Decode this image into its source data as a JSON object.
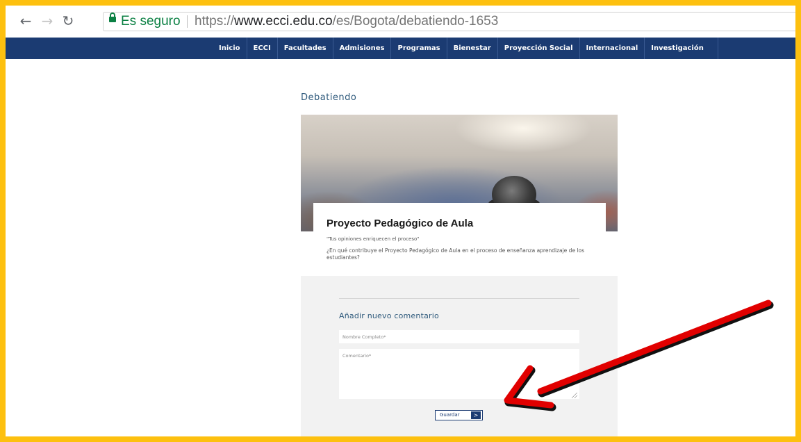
{
  "browser": {
    "secure_label": "Es seguro",
    "url_prefix": "https://",
    "url_host": "www.ecci.edu.co",
    "url_path": "/es/Bogota/debatiendo-1653",
    "back_icon": "back-arrow-icon",
    "forward_icon": "forward-arrow-icon",
    "reload_icon": "reload-icon",
    "lock_icon": "lock-icon"
  },
  "nav": {
    "items": [
      "Inicio",
      "ECCI",
      "Facultades",
      "Admisiones",
      "Programas",
      "Bienestar",
      "Proyección Social",
      "Internacional",
      "Investigación"
    ]
  },
  "page": {
    "title": "Debatiendo",
    "card_title": "Proyecto Pedagógico de Aula",
    "quote": "\"Tus opiniones enriquecen el proceso\"",
    "question": "¿En qué contribuye el Proyecto Pedagógico de Aula en el proceso de enseñanza aprendizaje de los estudiantes?"
  },
  "comments": {
    "heading": "Añadir nuevo comentario",
    "name_placeholder": "Nombre Completo*",
    "comment_placeholder": "Comentario*",
    "save_label": "Guardar",
    "save_arrow": ">"
  },
  "colors": {
    "frame": "#FDC00F",
    "nav_bg": "#1B3B72",
    "secure_green": "#0b8043",
    "annotation_arrow": "#E10000"
  }
}
